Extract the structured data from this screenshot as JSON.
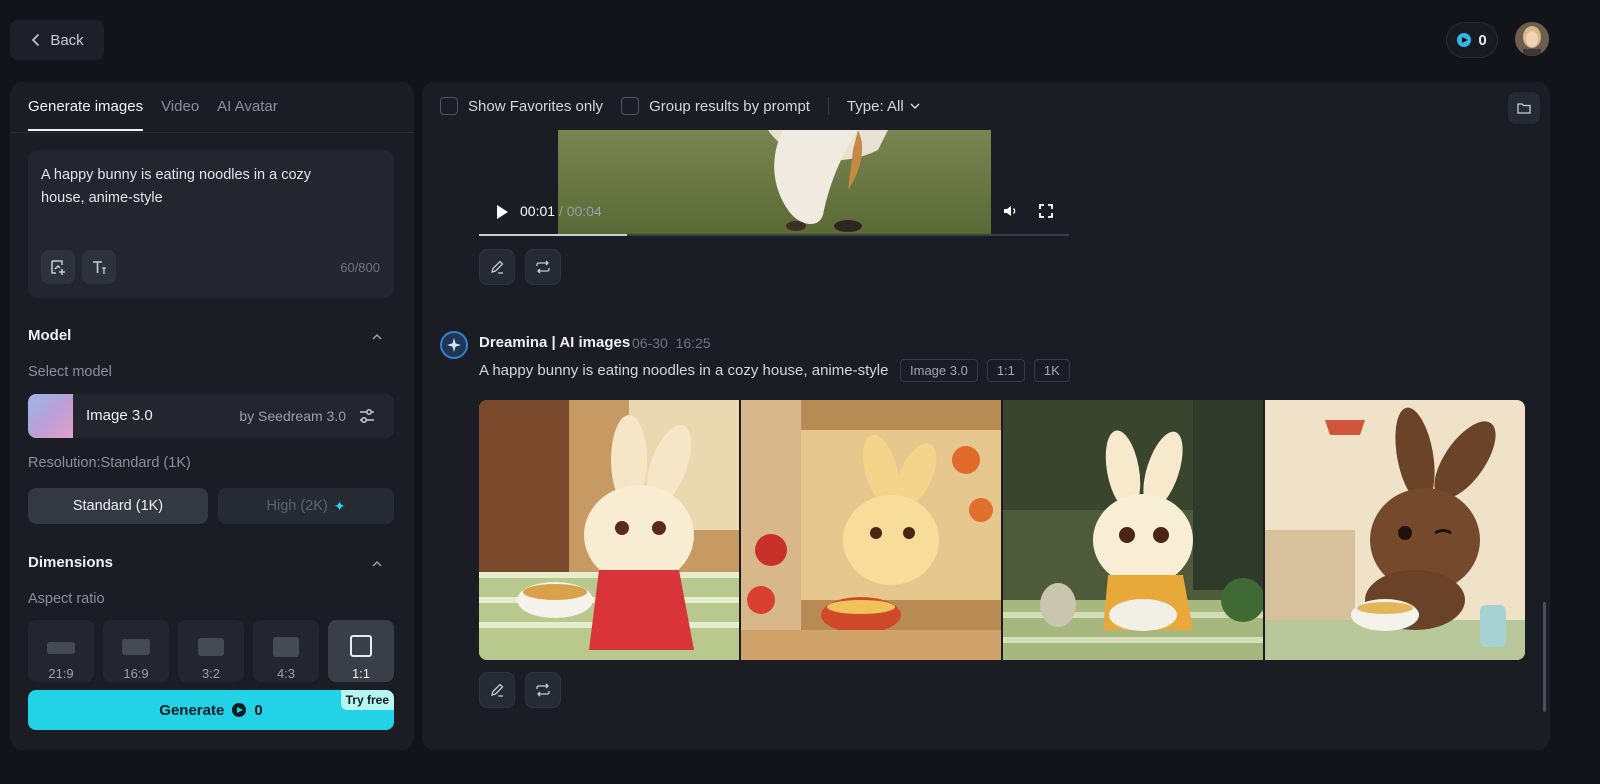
{
  "header": {
    "back_label": "Back",
    "credits": "0"
  },
  "left": {
    "tabs": [
      {
        "label": "Generate images",
        "active": true
      },
      {
        "label": "Video",
        "active": false
      },
      {
        "label": "AI Avatar",
        "active": false
      }
    ],
    "prompt": {
      "text": "A happy bunny is eating noodles in a cozy house, anime-style",
      "char_count": "60/800"
    },
    "model": {
      "section_title": "Model",
      "select_label": "Select model",
      "name": "Image 3.0",
      "by": "by Seedream 3.0"
    },
    "resolution": {
      "label": "Resolution:Standard (1K)",
      "standard": "Standard (1K)",
      "high": "High (2K)",
      "selected": "Standard (1K)"
    },
    "dimensions": {
      "section_title": "Dimensions",
      "aspect_label": "Aspect ratio",
      "ratios": [
        "21:9",
        "16:9",
        "3:2",
        "4:3",
        "1:1"
      ],
      "selected": "1:1"
    },
    "generate": {
      "label": "Generate",
      "cost": "0",
      "try_free": "Try free"
    }
  },
  "right": {
    "filters": {
      "favorites": "Show Favorites only",
      "group": "Group results by prompt",
      "type": "Type: All"
    },
    "video": {
      "current": "00:01",
      "duration": "/ 00:04",
      "progress": 0.25
    },
    "result": {
      "brand": "Dreamina | AI images",
      "date": "06-30",
      "time": "16:25",
      "prompt": "A happy bunny is eating noodles in a cozy house, anime-style",
      "badges": [
        "Image 3.0",
        "1:1",
        "1K"
      ]
    }
  },
  "colors": {
    "accent": "#22d2e6",
    "panel": "#1a1d24",
    "background": "#121419"
  }
}
